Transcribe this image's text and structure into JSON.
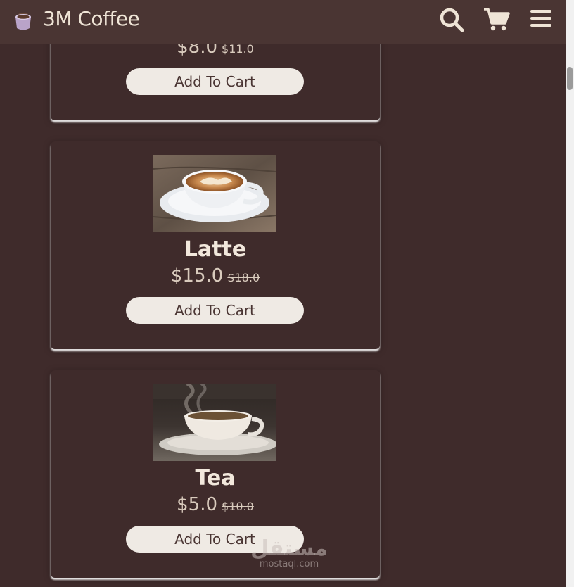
{
  "header": {
    "brand": "3M Coffee",
    "icons": [
      "coffee-cup-icon",
      "search-icon",
      "cart-icon",
      "menu-icon"
    ]
  },
  "products": [
    {
      "name": "",
      "price": "$8.0",
      "old_price": "$11.0",
      "button": "Add To Cart"
    },
    {
      "name": "Latte",
      "price": "$15.0",
      "old_price": "$18.0",
      "button": "Add To Cart"
    },
    {
      "name": "Tea",
      "price": "$5.0",
      "old_price": "$10.0",
      "button": "Add To Cart"
    }
  ],
  "watermark": {
    "arabic": "مستقل",
    "latin": "mostaql.com"
  },
  "colors": {
    "background": "#3f2b2b",
    "header": "#4a3533",
    "text_light": "#efe4d6",
    "button_bg": "#efeae4"
  }
}
